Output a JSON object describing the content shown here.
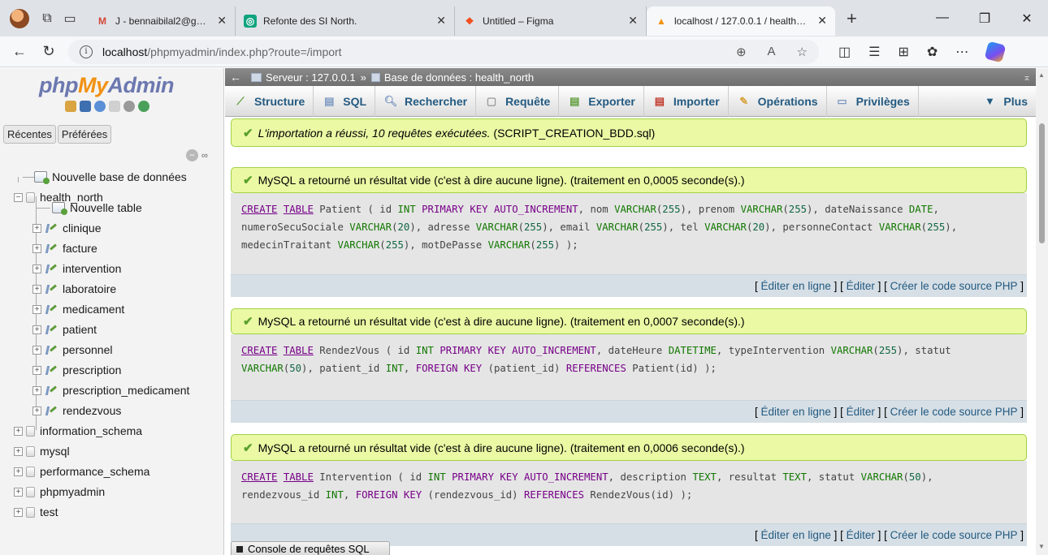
{
  "browser": {
    "tabs": [
      {
        "label": "J - bennaibilal2@gmail.com - G",
        "icon": "gmail-icon"
      },
      {
        "label": "Refonte des SI North.",
        "icon": "chatgpt-icon"
      },
      {
        "label": "Untitled – Figma",
        "icon": "figma-icon"
      },
      {
        "label": "localhost / 127.0.0.1 / health_no",
        "icon": "phpmyadmin-icon"
      }
    ],
    "url_host": "localhost",
    "url_path": "/phpmyadmin/index.php?route=/import"
  },
  "sidebar": {
    "logo_php": "php",
    "logo_my": "My",
    "logo_admin": "Admin",
    "tab_recent": "Récentes",
    "tab_favorites": "Préférées",
    "link_icon": "∞",
    "new_database": "Nouvelle base de données",
    "current_db": "health_north",
    "new_table": "Nouvelle table",
    "tables": [
      "clinique",
      "facture",
      "intervention",
      "laboratoire",
      "medicament",
      "patient",
      "personnel",
      "prescription",
      "prescription_medicament",
      "rendezvous"
    ],
    "other_dbs": [
      "information_schema",
      "mysql",
      "performance_schema",
      "phpmyadmin",
      "test"
    ]
  },
  "breadcrumb": {
    "server": "Serveur : 127.0.0.1",
    "separator": "»",
    "database": "Base de données : health_north"
  },
  "menu": {
    "structure": "Structure",
    "sql": "SQL",
    "search": "Rechercher",
    "query": "Requête",
    "export": "Exporter",
    "import": "Importer",
    "operations": "Opérations",
    "privileges": "Privilèges",
    "more": "Plus"
  },
  "import_result": {
    "success_italic": "L'importation a réussi, 10 requêtes exécutées.",
    "file": "(SCRIPT_CREATION_BDD.sql)"
  },
  "results": [
    {
      "message": "MySQL a retourné un résultat vide (c'est à dire aucune ligne). (traitement en 0,0005 seconde(s).)"
    },
    {
      "message": "MySQL a retourné un résultat vide (c'est à dire aucune ligne). (traitement en 0,0007 seconde(s).)"
    },
    {
      "message": "MySQL a retourné un résultat vide (c'est à dire aucune ligne). (traitement en 0,0006 seconde(s).)"
    }
  ],
  "result_links": {
    "inline_edit": "Éditer en ligne",
    "edit": "Éditer",
    "php_code": "Créer le code source PHP"
  },
  "console": "Console de requêtes SQL"
}
